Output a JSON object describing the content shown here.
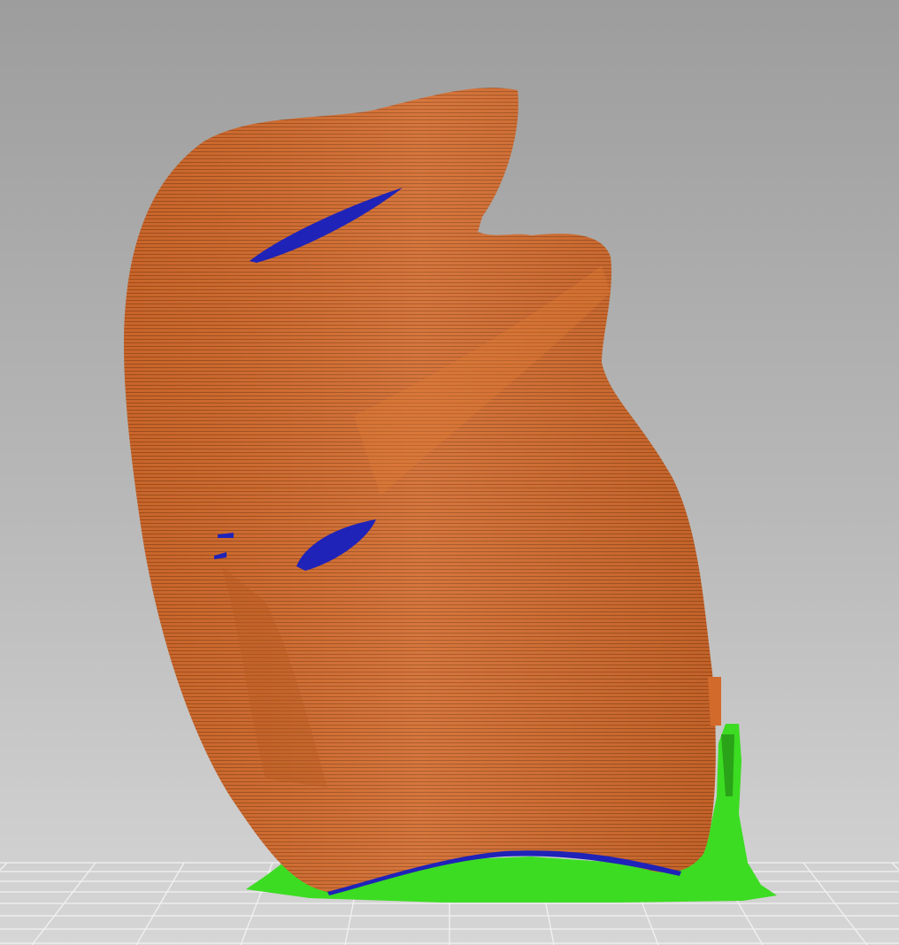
{
  "scene": {
    "view": "sliced-preview",
    "colors": {
      "perimeter": "#d9702f",
      "overhang": "#1f23b8",
      "support": "#33dd22",
      "bed_grid": "#f0f0f0"
    }
  }
}
